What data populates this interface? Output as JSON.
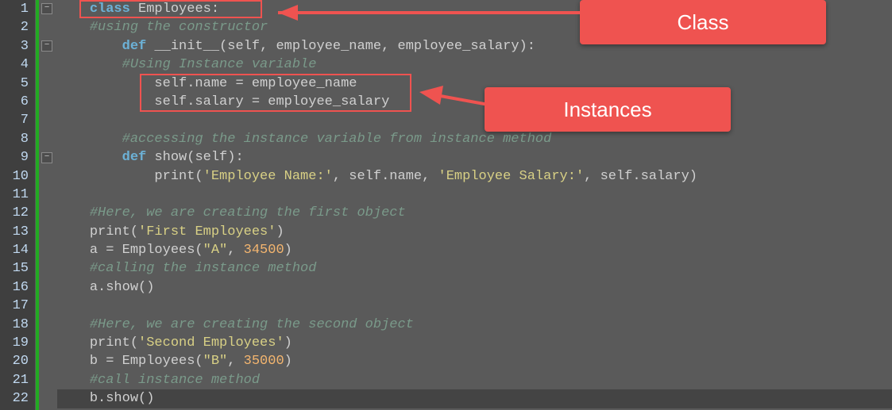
{
  "lineCount": 22,
  "code": {
    "l1": {
      "a": "class ",
      "b": "Employees",
      "c": ":"
    },
    "l2": "#using the constructor",
    "l3": {
      "a": "def ",
      "b": "__init__",
      "c": "(",
      "d": "self",
      "e": ", employee_name, employee_salary):"
    },
    "l4": "#Using Instance variable",
    "l5": {
      "a": "self",
      "b": ".name = employee_name"
    },
    "l6": {
      "a": "self",
      "b": ".salary = employee_salary"
    },
    "l8": "#accessing the instance variable from instance method",
    "l9": {
      "a": "def ",
      "b": "show",
      "c": "(",
      "d": "self",
      "e": "):"
    },
    "l10": {
      "a": "print(",
      "b": "'Employee Name:'",
      "c": ", ",
      "d": "self",
      "e": ".name, ",
      "f": "'Employee Salary:'",
      "g": ", ",
      "h": "self",
      "i": ".salary)"
    },
    "l12": "#Here, we are creating the first object",
    "l13": {
      "a": "print(",
      "b": "'First Employees'",
      "c": ")"
    },
    "l14": {
      "a": "a = Employees(",
      "b": "\"A\"",
      "c": ", ",
      "d": "34500",
      "e": ")"
    },
    "l15": "#calling the instance method",
    "l16": "a.show()",
    "l18": "#Here, we are creating the second object",
    "l19": {
      "a": "print(",
      "b": "'Second Employees'",
      "c": ")"
    },
    "l20": {
      "a": "b = Employees(",
      "b": "\"B\"",
      "c": ", ",
      "d": "35000",
      "e": ")"
    },
    "l21": "#call instance method",
    "l22": "b.show()"
  },
  "callouts": {
    "class": "Class",
    "instances": "Instances"
  }
}
